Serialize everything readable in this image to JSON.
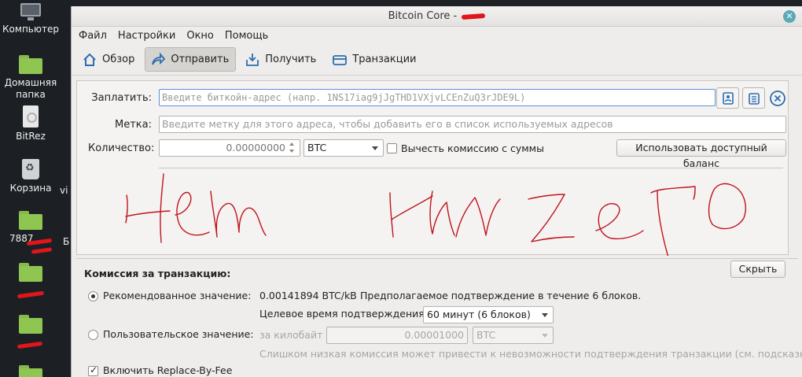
{
  "desktop": {
    "items": [
      {
        "label": "Компьютер"
      },
      {
        "label": "Домашняя папка"
      },
      {
        "label": "BitRez"
      },
      {
        "label": "Корзина"
      },
      {
        "label": "7887"
      },
      {
        "label": ""
      },
      {
        "label": ""
      }
    ],
    "partial_label": "vi",
    "partial_label2": "Б"
  },
  "window": {
    "title": "Bitcoin Core -",
    "menu": [
      "Файл",
      "Настройки",
      "Окно",
      "Помощь"
    ],
    "toolbar": [
      {
        "label": "Обзор",
        "icon": "home-icon"
      },
      {
        "label": "Отправить",
        "icon": "send-icon",
        "active": true
      },
      {
        "label": "Получить",
        "icon": "receive-icon"
      },
      {
        "label": "Транзакции",
        "icon": "transactions-icon"
      }
    ]
  },
  "send": {
    "pay_to_label": "Заплатить:",
    "pay_to_placeholder": "Введите биткойн-адрес (напр. 1NS17iag9jJgTHD1VXjvLCEnZuQ3rJDE9L)",
    "label_label": "Метка:",
    "label_placeholder": "Введите метку для этого адреса, чтобы добавить его в список используемых адресов",
    "amount_label": "Количество:",
    "amount_value": "0.00000000",
    "unit": "BTC",
    "subtract_fee_label": "Вычесть комиссию с суммы",
    "use_balance_button": "Использовать доступный баланс"
  },
  "fee": {
    "title": "Комиссия за транзакцию:",
    "hide_button": "Скрыть",
    "recommended_label": "Рекомендованное значение:",
    "recommended_rate": "0.00141894 BTC/kB",
    "recommended_note": "Предполагаемое подтверждение в течение 6 блоков.",
    "target_label": "Целевое время подтверждения",
    "target_value": "60 минут (6 блоков)",
    "custom_label": "Пользовательское значение:",
    "per_kb_label": "за килобайт",
    "custom_value": "0.00001000",
    "custom_unit": "BTC",
    "warning": "Слишком низкая комиссия может привести к невозможности подтверждения транзакции (см. подсказку)",
    "rbf_label": "Включить Replace-By-Fee"
  }
}
